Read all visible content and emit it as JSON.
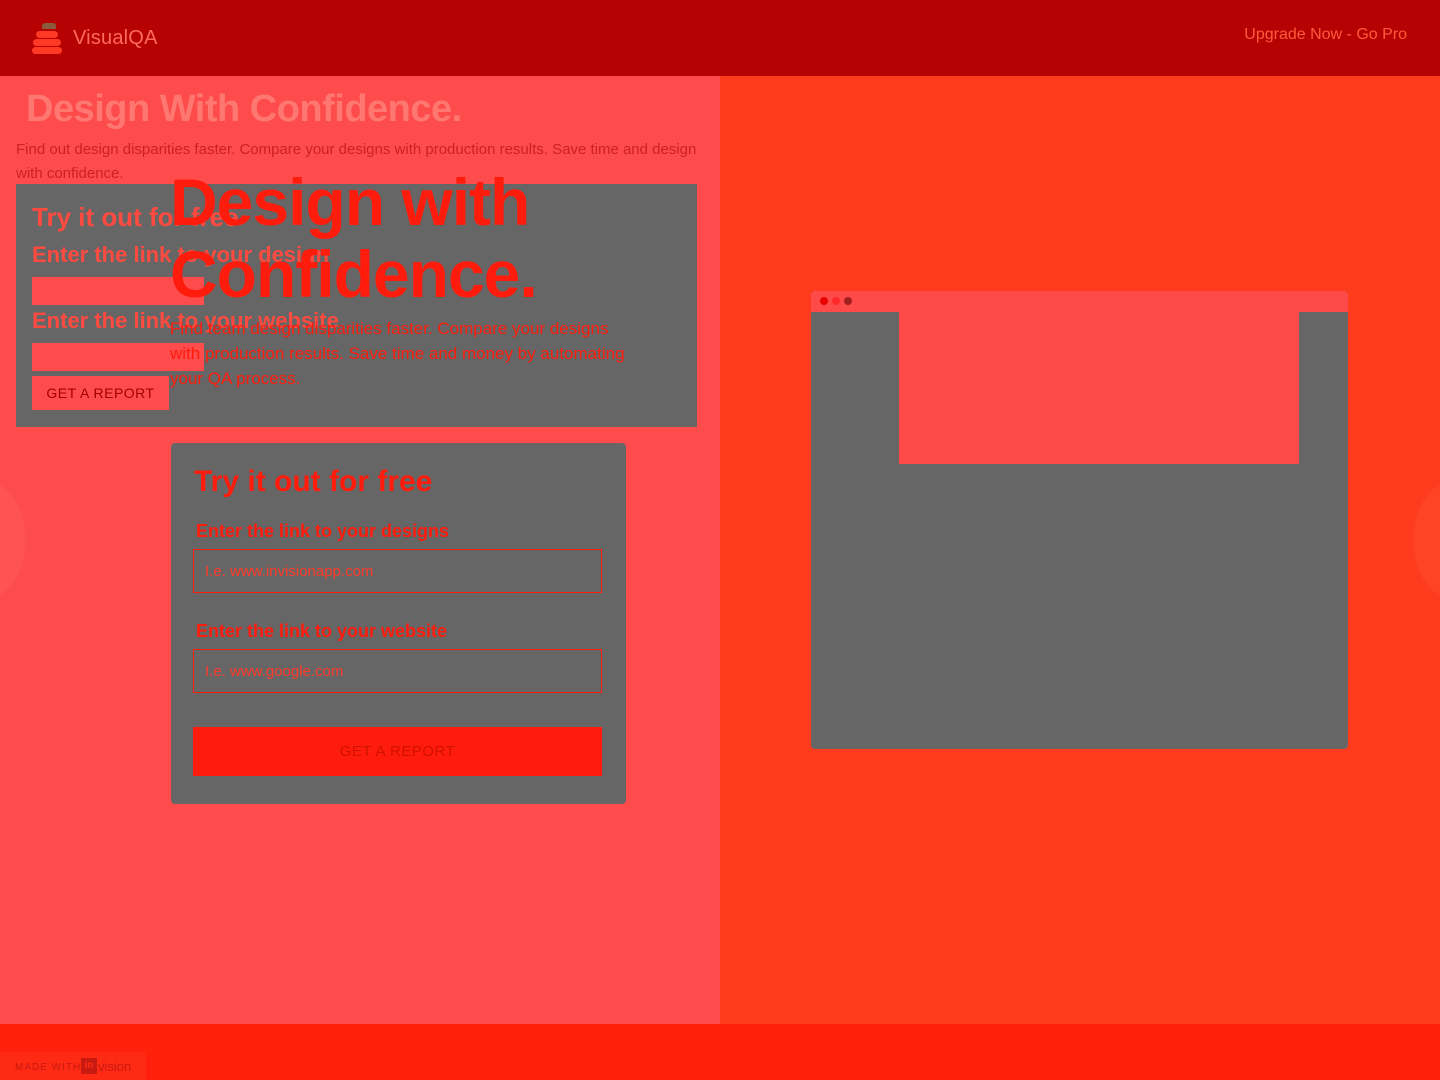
{
  "header": {
    "logo_text": "VisualQA",
    "upgrade_label": "Upgrade Now - Go Pro"
  },
  "ghost": {
    "title": "Design With Confidence.",
    "subtitle": "Find out design disparities faster. Compare your designs with production results. Save time and design with confidence.",
    "card_title": "Try it out for free",
    "label_designs": "Enter the link to your design",
    "label_website": "Enter the link to your website",
    "button": "GET A REPORT"
  },
  "hero": {
    "title": "Design with Confidence.",
    "subtitle": "Find team design disparities faster. Compare your designs with production results. Save time and money by automating your QA process."
  },
  "form": {
    "title": "Try it out for free",
    "designs_label": "Enter the link to your designs",
    "designs_placeholder": "I.e. www.invisionapp.com",
    "website_label": "Enter the link to your website",
    "website_placeholder": "I.e. www.google.com",
    "submit_label": "GET A REPORT"
  },
  "footer": {
    "made_with": "MADE WITH",
    "in_mark": "in",
    "brand": "vision"
  }
}
